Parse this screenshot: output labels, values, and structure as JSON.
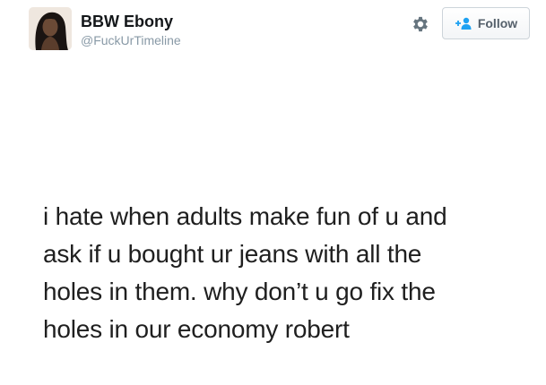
{
  "user": {
    "display_name": "BBW Ebony",
    "username": "@FuckUrTimeline"
  },
  "actions": {
    "settings_icon": "gear-icon",
    "follow_icon": "add-user-icon",
    "follow_label": "Follow"
  },
  "tweet": {
    "lines": [
      "i hate when adults make fun of u and",
      "ask if u bought ur jeans with all the",
      "holes in them. why don’t u go fix the",
      "holes in our economy robert"
    ]
  },
  "colors": {
    "accent": "#1da1f2",
    "name_text": "#14171a",
    "handle_text": "#8899a6",
    "body_text": "#1f1f1f"
  }
}
